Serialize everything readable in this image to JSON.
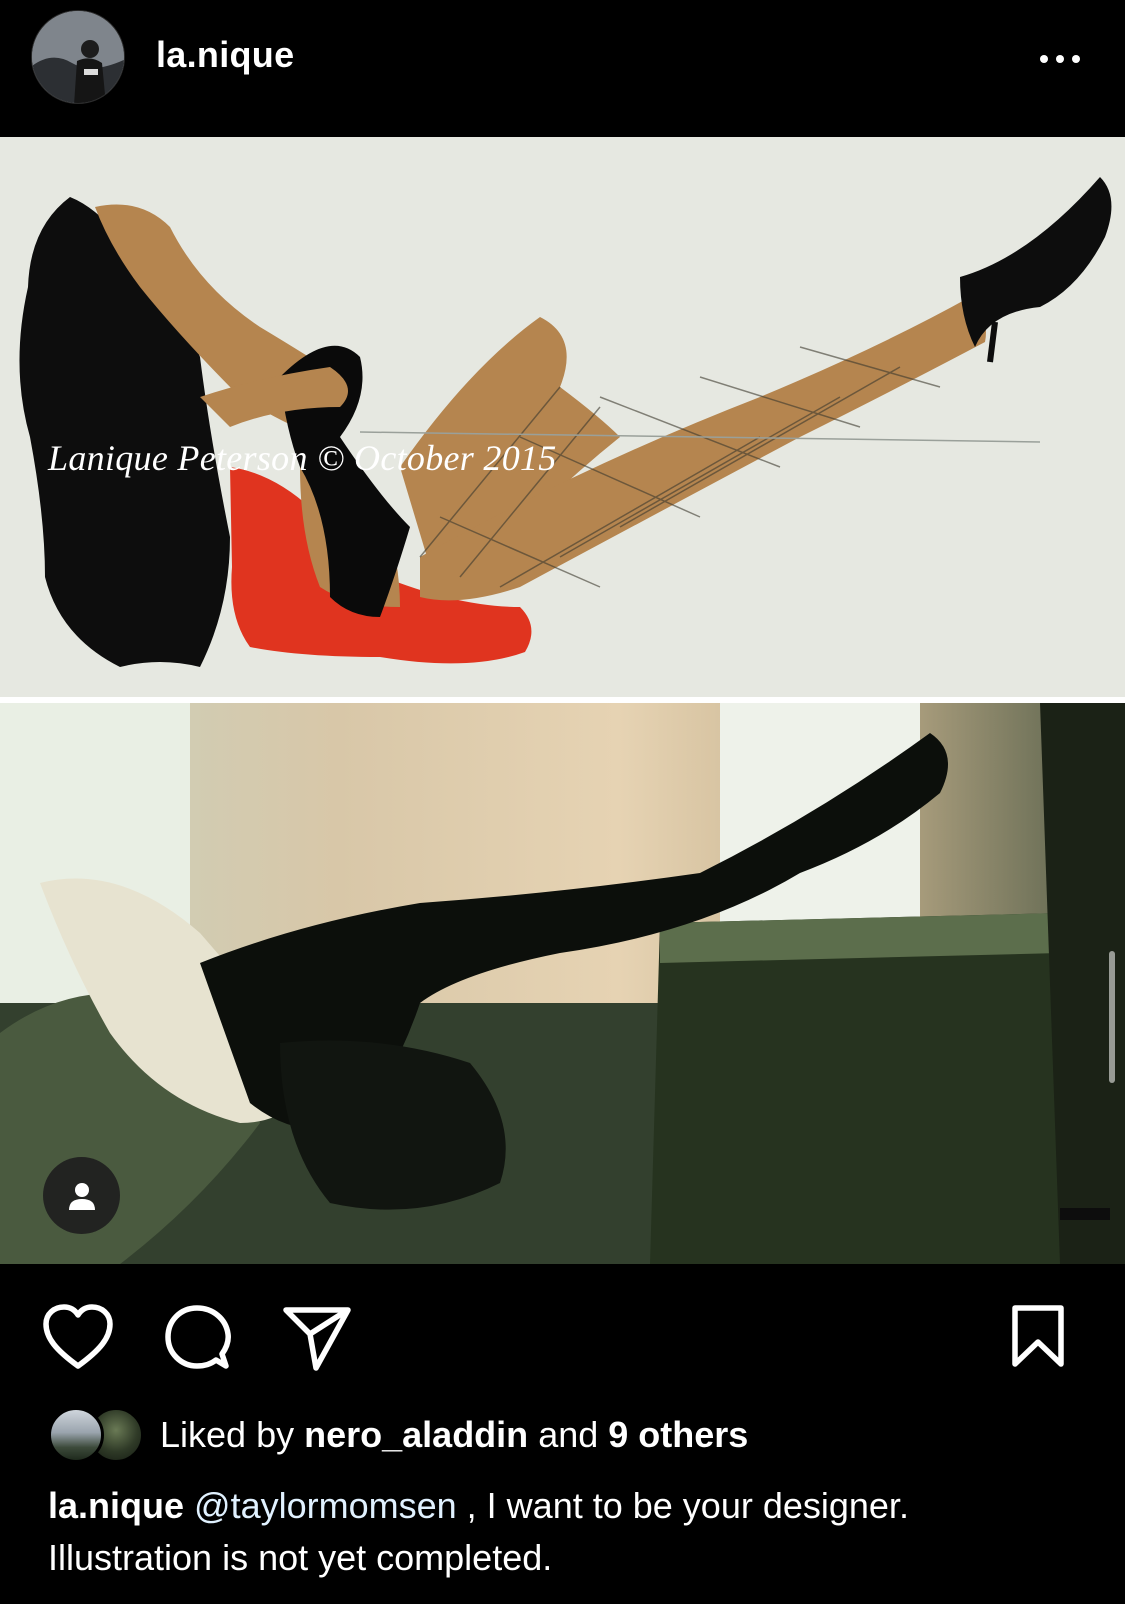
{
  "post": {
    "username": "la.nique",
    "image_watermark": "Lanique Peterson © October 2015",
    "more_icon": "more-horizontal-icon",
    "tag_icon": "person-icon"
  },
  "actions": {
    "icons": [
      "heart-icon",
      "comment-icon",
      "share-icon",
      "bookmark-icon"
    ]
  },
  "likes": {
    "prefix": "Liked by",
    "user": "nero_aladdin",
    "and": "and",
    "others": "9 others"
  },
  "caption": {
    "username": "la.nique",
    "mention": "@taylormomsen",
    "text_line1": " , I want to be your designer.",
    "text_line2": "Illustration is not yet completed."
  },
  "colors": {
    "background": "#000000",
    "text": "#ffffff",
    "mention": "#e0f1ff"
  }
}
